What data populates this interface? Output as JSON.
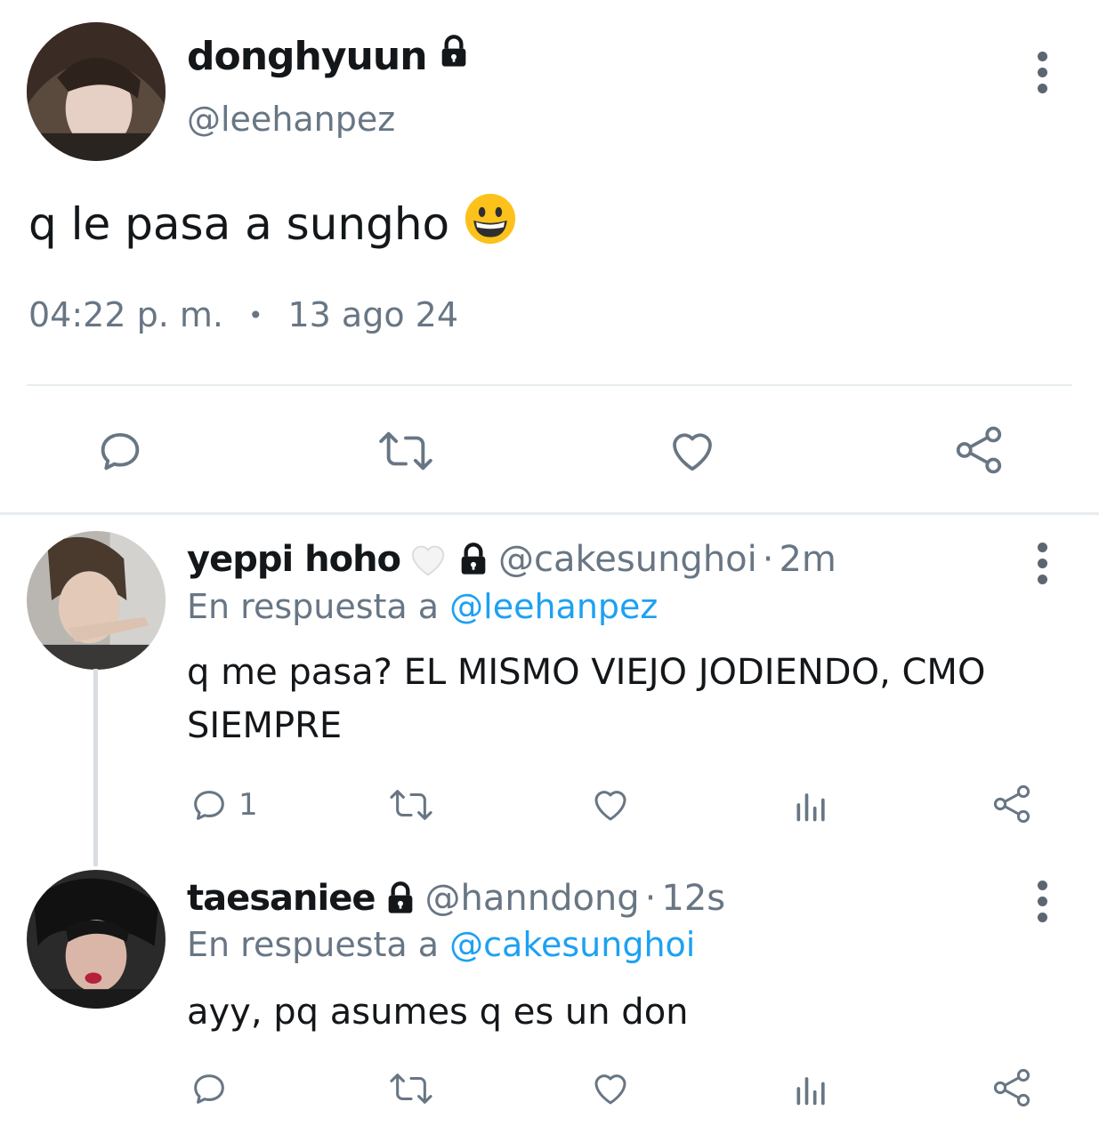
{
  "main_tweet": {
    "display_name": "donghyuun",
    "handle": "@leehanpez",
    "text": "q le pasa a sungho",
    "emoji": "grinning-face",
    "time": "04:22 p. m.",
    "separator": "•",
    "date": "13 ago 24"
  },
  "replies": [
    {
      "display_name": "yeppi hoho",
      "name_emoji": "white-heart",
      "handle": "@cakesunghoi",
      "separator": "·",
      "time": "2m",
      "reply_prefix": "En respuesta a ",
      "reply_to": "@leehanpez",
      "text": "q me pasa? EL MISMO VIEJO JODIENDO, CMO SIEMPRE",
      "reply_count": "1"
    },
    {
      "display_name": "taesaniee",
      "handle": "@hanndong",
      "separator": "·",
      "time": "12s",
      "reply_prefix": "En respuesta a ",
      "reply_to": "@cakesunghoi",
      "text": "ayy, pq asumes q es un don"
    }
  ],
  "colors": {
    "text": "#14171a",
    "secondary": "#687684",
    "link": "#1da1f2",
    "divider": "#e6ecf0",
    "icon": "#687684"
  }
}
